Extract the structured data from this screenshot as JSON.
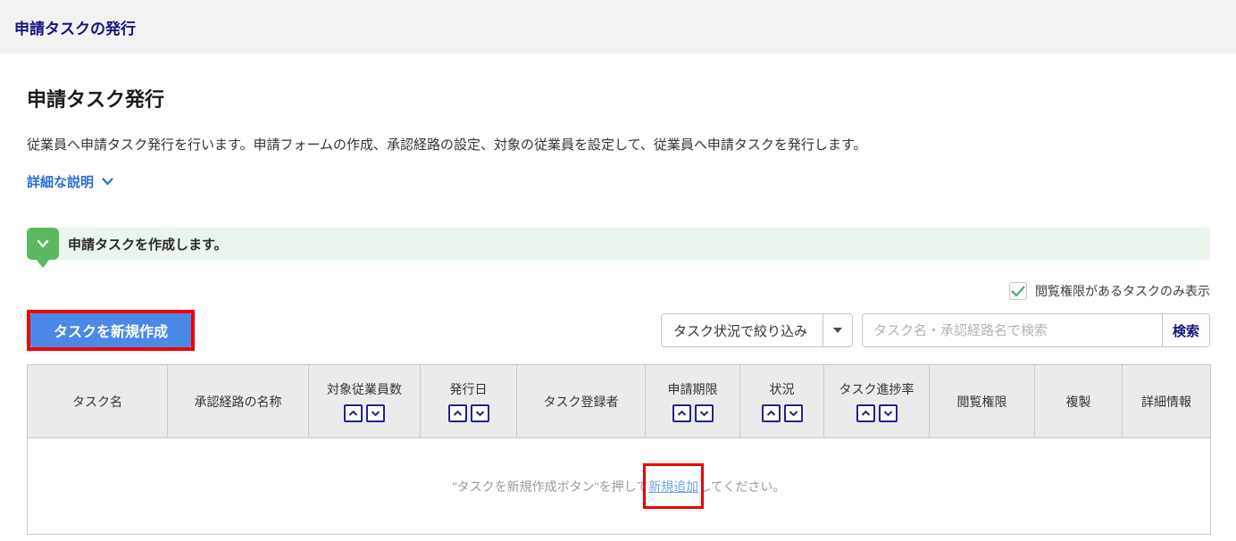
{
  "topbar": {
    "title": "申請タスクの発行"
  },
  "main": {
    "heading": "申請タスク発行",
    "description": "従業員へ申請タスク発行を行います。申請フォームの作成、承認経路の設定、対象の従業員を設定して、従業員へ申請タスクを発行します。",
    "details_link_label": "詳細な説明"
  },
  "banner": {
    "message": "申請タスクを作成します。"
  },
  "filters": {
    "view_permission_checkbox_label": "閲覧権限があるタスクのみ表示",
    "view_permission_checked": true,
    "status_filter_label": "タスク状況で絞り込み",
    "search_placeholder": "タスク名・承認経路名で検索",
    "search_button_label": "検索"
  },
  "toolbar": {
    "create_task_button_label": "タスクを新規作成"
  },
  "table": {
    "columns": [
      {
        "label": "タスク名",
        "sortable": false
      },
      {
        "label": "承認経路の名称",
        "sortable": false
      },
      {
        "label": "対象従業員数",
        "sortable": true
      },
      {
        "label": "発行日",
        "sortable": true
      },
      {
        "label": "タスク登録者",
        "sortable": false
      },
      {
        "label": "申請期限",
        "sortable": true
      },
      {
        "label": "状況",
        "sortable": true
      },
      {
        "label": "タスク進捗率",
        "sortable": true
      },
      {
        "label": "閲覧権限",
        "sortable": false
      },
      {
        "label": "複製",
        "sortable": false
      },
      {
        "label": "詳細情報",
        "sortable": false
      }
    ],
    "empty_row": {
      "text_before_link": "\"タスクを新規作成ボタン\"を押して",
      "link_label": "新規追加",
      "text_after_link": "してください。"
    }
  },
  "colors": {
    "accent_navy": "#15157d",
    "button_blue": "#4a89e8",
    "annotation_red": "#ee0000",
    "banner_green": "#5cb860",
    "link_blue": "#2b6fd4",
    "check_green": "#3ca56a",
    "header_gray": "#ebebeb"
  }
}
